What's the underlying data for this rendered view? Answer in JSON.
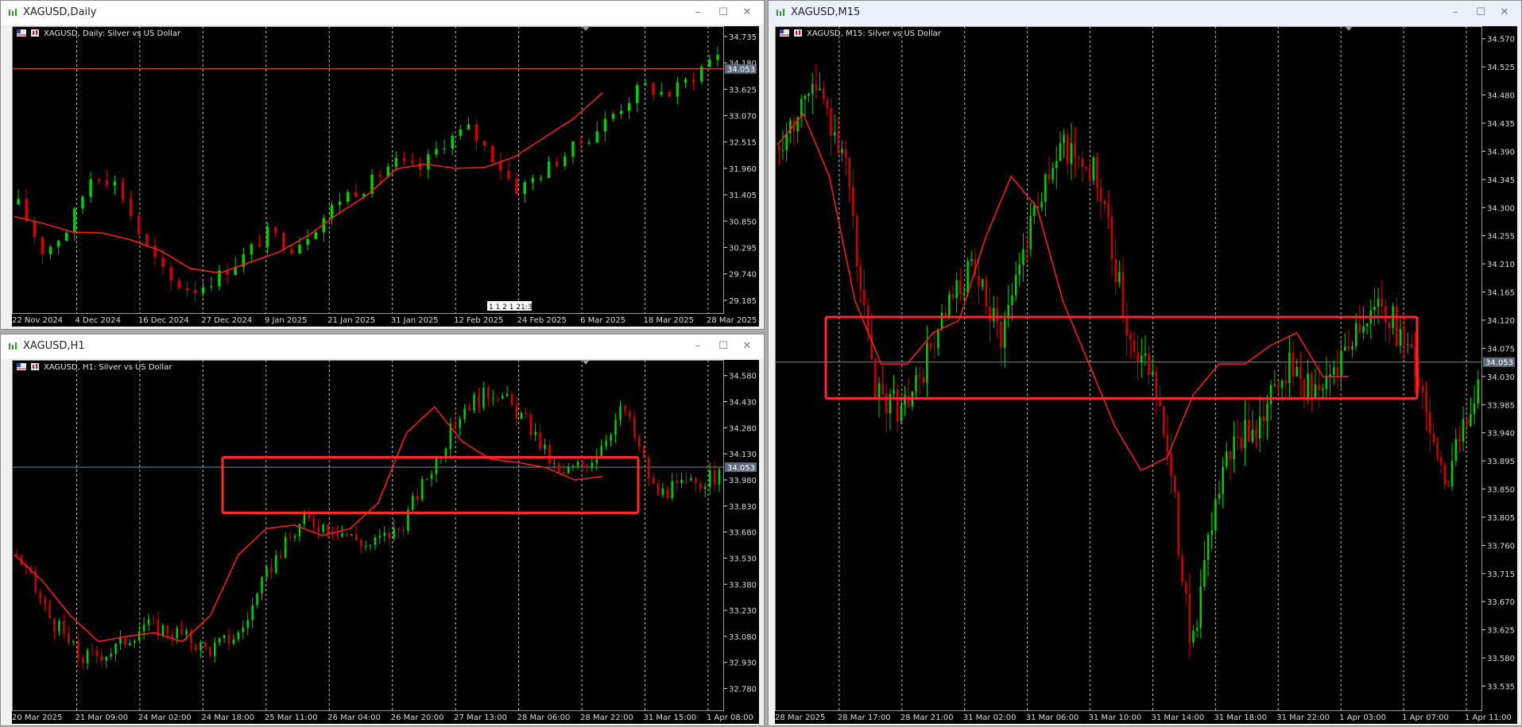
{
  "windows": [
    {
      "id": "daily",
      "title": "XAGUSD,Daily",
      "chart_label": "XAGUSD, Daily:  Silver vs US Dollar",
      "chart_data": {
        "type": "candlestick",
        "symbol": "XAGUSD",
        "timeframe": "Daily",
        "y_ticks": [
          "34.735",
          "34.180",
          "33.625",
          "33.070",
          "32.515",
          "31.960",
          "31.405",
          "30.850",
          "30.295",
          "29.740",
          "29.185"
        ],
        "y_range": [
          28.9,
          34.95
        ],
        "x_ticks": [
          "22 Nov 2024",
          "4 Dec 2024",
          "16 Dec 2024",
          "27 Dec 2024",
          "9 Jan 2025",
          "21 Jan 2025",
          "31 Jan 2025",
          "12 Feb 2025",
          "24 Feb 2025",
          "6 Mar 2025",
          "18 Mar 2025",
          "28 Mar 2025"
        ],
        "current_price": "34.053",
        "bid_line": 34.053,
        "cursor_label": "1 1 2 1 21:30",
        "ma_points": [
          30.95,
          30.8,
          30.62,
          30.6,
          30.45,
          30.22,
          29.85,
          29.76,
          29.98,
          30.2,
          30.55,
          31.0,
          31.4,
          31.95,
          32.05,
          31.96,
          31.98,
          32.2,
          32.6,
          33.0,
          33.55
        ],
        "close_series": [
          31.2,
          30.2,
          30.7,
          31.9,
          31.6,
          30.4,
          29.6,
          29.4,
          29.7,
          30.1,
          30.6,
          30.3,
          30.8,
          31.4,
          31.6,
          32.1,
          31.9,
          32.5,
          32.8,
          32.2,
          31.5,
          31.9,
          32.3,
          32.7,
          33.2,
          33.7,
          33.5,
          33.9,
          34.4
        ]
      }
    },
    {
      "id": "h1",
      "title": "XAGUSD,H1",
      "chart_label": "XAGUSD, H1:  Silver vs US Dollar",
      "chart_data": {
        "type": "candlestick",
        "symbol": "XAGUSD",
        "timeframe": "H1",
        "y_ticks": [
          "34.580",
          "34.430",
          "34.280",
          "34.130",
          "33.980",
          "33.830",
          "33.680",
          "33.530",
          "33.380",
          "33.230",
          "33.080",
          "32.930",
          "32.780"
        ],
        "y_range": [
          32.65,
          34.67
        ],
        "x_ticks": [
          "20 Mar 2025",
          "21 Mar 09:00",
          "24 Mar 02:00",
          "24 Mar 18:00",
          "25 Mar 11:00",
          "26 Mar 04:00",
          "26 Mar 20:00",
          "27 Mar 13:00",
          "28 Mar 06:00",
          "28 Mar 22:00",
          "31 Mar 15:00",
          "1 Apr 08:00"
        ],
        "current_price": "34.053",
        "bid_line": 34.053,
        "highlight_box": {
          "price_top": 34.11,
          "price_bottom": 33.79
        },
        "ma_points": [
          33.55,
          33.4,
          33.2,
          33.05,
          33.08,
          33.1,
          33.05,
          33.2,
          33.55,
          33.7,
          33.72,
          33.66,
          33.7,
          33.85,
          34.25,
          34.4,
          34.2,
          34.1,
          34.08,
          34.05,
          33.98,
          34.0
        ],
        "close_series": [
          33.55,
          33.2,
          32.95,
          33.0,
          33.15,
          33.1,
          33.0,
          33.1,
          33.5,
          33.75,
          33.7,
          33.6,
          33.7,
          34.05,
          34.4,
          34.5,
          34.3,
          34.0,
          34.1,
          34.4,
          33.9,
          33.95,
          34.0
        ]
      }
    },
    {
      "id": "m15",
      "title": "XAGUSD,M15",
      "chart_label": "XAGUSD, M15:  Silver vs US Dollar",
      "chart_data": {
        "type": "candlestick",
        "symbol": "XAGUSD",
        "timeframe": "M15",
        "y_ticks": [
          "34.570",
          "34.525",
          "34.480",
          "34.435",
          "34.390",
          "34.345",
          "34.300",
          "34.255",
          "34.210",
          "34.165",
          "34.120",
          "34.075",
          "34.030",
          "33.985",
          "33.940",
          "33.895",
          "33.850",
          "33.805",
          "33.760",
          "33.715",
          "33.670",
          "33.625",
          "33.580",
          "33.535"
        ],
        "y_range": [
          33.495,
          34.59
        ],
        "x_ticks": [
          "28 Mar 2025",
          "28 Mar 17:00",
          "28 Mar 21:00",
          "31 Mar 02:00",
          "31 Mar 06:00",
          "31 Mar 10:00",
          "31 Mar 14:00",
          "31 Mar 18:00",
          "31 Mar 22:00",
          "1 Apr 03:00",
          "1 Apr 07:00",
          "1 Apr 11:00"
        ],
        "current_price": "34.053",
        "bid_line": 34.053,
        "highlight_box": {
          "price_top": 34.125,
          "price_bottom": 33.995
        },
        "ma_points": [
          34.4,
          34.45,
          34.35,
          34.15,
          34.05,
          34.05,
          34.1,
          34.12,
          34.25,
          34.35,
          34.3,
          34.15,
          34.05,
          33.95,
          33.88,
          33.9,
          34.0,
          34.05,
          34.05,
          34.08,
          34.1,
          34.03,
          34.03
        ],
        "close_series": [
          34.4,
          34.5,
          34.4,
          34.0,
          33.98,
          34.1,
          34.2,
          34.1,
          34.3,
          34.4,
          34.35,
          34.1,
          34.0,
          33.6,
          33.9,
          33.95,
          34.05,
          34.0,
          34.1,
          34.15,
          34.05,
          33.85,
          34.03
        ]
      }
    }
  ],
  "controls": {
    "minimize": "–",
    "maximize": "☐",
    "close": "✕"
  },
  "colors": {
    "bull": "#00d000",
    "bear": "#d00000",
    "ma": "#ff1f1f",
    "box": "#ff2a2a",
    "axis_text": "#dcdcdc",
    "grid": "#bfbfbf"
  }
}
